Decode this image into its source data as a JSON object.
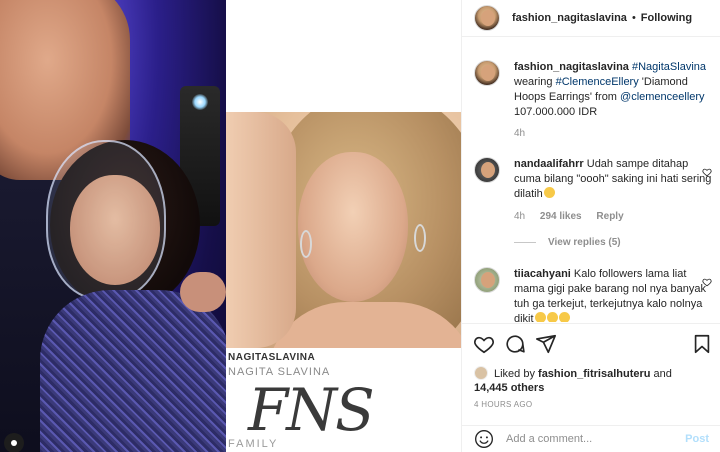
{
  "header": {
    "username": "fashion_nagitaslavina",
    "separator": "•",
    "follow_state": "Following"
  },
  "caption": {
    "username": "fashion_nagitaslavina",
    "hashtag": "#NagitaSlavina",
    "text_1": " wearing ",
    "brand_tag": "#ClemenceEllery",
    "text_2": " 'Diamond Hoops Earrings' from ",
    "mention": "@clemenceellery",
    "text_3": " 107.000.000 IDR",
    "time": "4h"
  },
  "comments": [
    {
      "username": "nandaalifahrr",
      "text": "Udah sampe ditahap cuma bilang \"oooh\" saking ini hati sering dilatih",
      "time": "4h",
      "likes": "294 likes",
      "reply": "Reply",
      "view_replies": "View replies (5)"
    },
    {
      "username": "tiiacahyani",
      "text": "Kalo followers lama liat mama gigi pake barang nol nya banyak tuh ga terkejut, terkejutnya kalo nolnya dikit"
    }
  ],
  "likes": {
    "prefix": "Liked by ",
    "user": "fashion_fitrisalhuteru",
    "mid": " and",
    "count": "14,445 others"
  },
  "timestamp": "4 HOURS AGO",
  "add_comment": {
    "placeholder": "Add a comment...",
    "post_label": "Post"
  },
  "media": {
    "brand_line1": "NAGITASLAVINA",
    "brand_line2": "NAGITA SLAVINA",
    "brand_mark": "FNS",
    "brand_sub": "FAMILY"
  },
  "icons": [
    "heart-icon",
    "comment-icon",
    "share-icon",
    "bookmark-icon",
    "emoji-icon",
    "small-heart-icon"
  ],
  "colors": {
    "link": "#00376b",
    "muted": "#8e8e8e",
    "post_disabled": "#b2dffc",
    "border": "#efefef"
  }
}
